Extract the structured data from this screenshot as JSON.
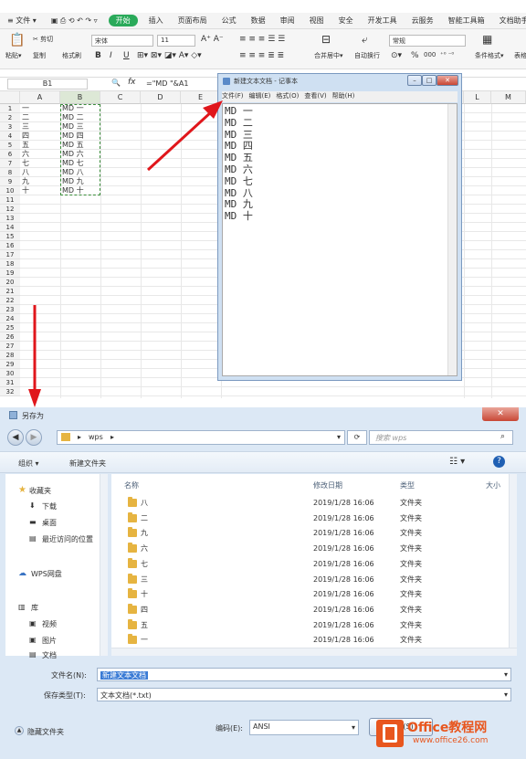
{
  "wps": {
    "menu": [
      "≡ 文件 ▾",
      "开始",
      "插入",
      "页面布局",
      "公式",
      "数据",
      "审阅",
      "视图",
      "安全",
      "开发工具",
      "云服务",
      "智能工具箱",
      "文档助手"
    ],
    "ribbon": {
      "paste": "粘贴▾",
      "cut": "✂ 剪切",
      "copy": "复制",
      "format_painter": "格式刷",
      "font_name": "宋体",
      "font_size": "11",
      "merge": "合并居中▾",
      "wrap": "自动换行",
      "number_format": "常规",
      "percent": "%",
      "decimals": "000",
      "cond_format": "条件格式▾",
      "table_style": "表格样式"
    },
    "name_box": "B1",
    "fx_label": "fx",
    "formula": "=\"MD \"&A1",
    "columns": [
      "A",
      "B",
      "C",
      "D",
      "E",
      "L",
      "M"
    ],
    "rows": [
      "1",
      "2",
      "3",
      "4",
      "5",
      "6",
      "7",
      "8",
      "9",
      "10",
      "11",
      "12",
      "13",
      "14",
      "15",
      "16",
      "17",
      "18",
      "19",
      "20",
      "21",
      "22",
      "23",
      "24",
      "25",
      "26",
      "27",
      "28",
      "29",
      "30",
      "31",
      "32"
    ],
    "col_a": [
      "一",
      "二",
      "三",
      "四",
      "五",
      "六",
      "七",
      "八",
      "九",
      "十"
    ],
    "col_b": [
      "MD 一",
      "MD 二",
      "MD 三",
      "MD 四",
      "MD 五",
      "MD 六",
      "MD 七",
      "MD 八",
      "MD 九",
      "MD 十"
    ]
  },
  "notepad": {
    "title": "新建文本文档 - 记事本",
    "menu": [
      "文件(F)",
      "编辑(E)",
      "格式(O)",
      "查看(V)",
      "帮助(H)"
    ],
    "lines": [
      "MD 一",
      "MD 二",
      "MD 三",
      "MD 四",
      "MD 五",
      "MD 六",
      "MD 七",
      "MD 八",
      "MD 九",
      "MD 十"
    ]
  },
  "dialog": {
    "title": "另存为",
    "path": "wps",
    "search_placeholder": "搜索 wps",
    "organize": "组织 ▾",
    "new_folder": "新建文件夹",
    "nav": [
      "收藏夹",
      "下载",
      "桌面",
      "最近访问的位置",
      "WPS网盘",
      "库",
      "视频",
      "图片",
      "文档"
    ],
    "columns": {
      "name": "名称",
      "date": "修改日期",
      "type": "类型",
      "size": "大小"
    },
    "files": [
      {
        "name": "八",
        "date": "2019/1/28 16:06",
        "type": "文件夹"
      },
      {
        "name": "二",
        "date": "2019/1/28 16:06",
        "type": "文件夹"
      },
      {
        "name": "九",
        "date": "2019/1/28 16:06",
        "type": "文件夹"
      },
      {
        "name": "六",
        "date": "2019/1/28 16:06",
        "type": "文件夹"
      },
      {
        "name": "七",
        "date": "2019/1/28 16:06",
        "type": "文件夹"
      },
      {
        "name": "三",
        "date": "2019/1/28 16:06",
        "type": "文件夹"
      },
      {
        "name": "十",
        "date": "2019/1/28 16:06",
        "type": "文件夹"
      },
      {
        "name": "四",
        "date": "2019/1/28 16:06",
        "type": "文件夹"
      },
      {
        "name": "五",
        "date": "2019/1/28 16:06",
        "type": "文件夹"
      },
      {
        "name": "一",
        "date": "2019/1/28 16:06",
        "type": "文件夹"
      }
    ],
    "filename_label": "文件名(N):",
    "filename": "新建文本文档",
    "filetype_label": "保存类型(T):",
    "filetype": "文本文档(*.txt)",
    "encoding_label": "编码(E):",
    "encoding": "ANSI",
    "hide_folders": "隐藏文件夹",
    "save": "保存(S)",
    "watermark_brand": "Office教程网",
    "watermark_url": "www.office26.com"
  },
  "colors": {
    "accent": "#2aaa5a",
    "arrow": "#e0161b",
    "selection": "#3a8d3a"
  }
}
